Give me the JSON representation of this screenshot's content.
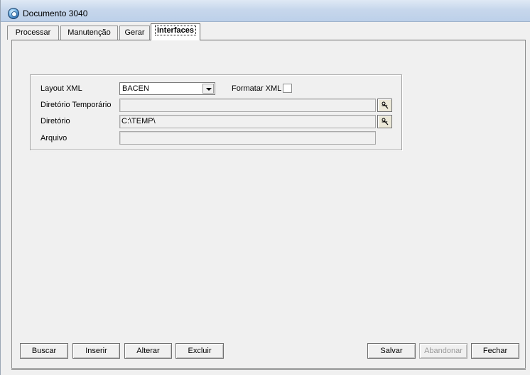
{
  "window": {
    "title": "Documento 3040"
  },
  "tabs": [
    {
      "label": "Processar"
    },
    {
      "label": "Manutenção"
    },
    {
      "label": "Gerar"
    },
    {
      "label": "Interfaces"
    }
  ],
  "interfaces": {
    "layout_xml": {
      "label": "Layout XML",
      "value": "BACEN"
    },
    "formatar_xml": {
      "label": "Formatar XML",
      "checked": false
    },
    "diretorio_temporario": {
      "label": "Diretório Temporário",
      "value": ""
    },
    "diretorio": {
      "label": "Diretório",
      "value": "C:\\TEMP\\"
    },
    "arquivo": {
      "label": "Arquivo",
      "value": ""
    }
  },
  "buttons": {
    "buscar": "Buscar",
    "inserir": "Inserir",
    "alterar": "Alterar",
    "excluir": "Excluir",
    "salvar": "Salvar",
    "abandonar": "Abandonar",
    "fechar": "Fechar"
  },
  "icons": {
    "app": "app-globe-icon",
    "browse": "folder-browse-icon",
    "dropdown": "chevron-down-icon"
  }
}
